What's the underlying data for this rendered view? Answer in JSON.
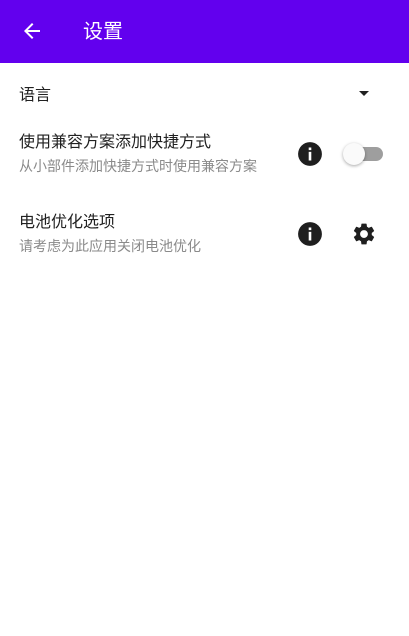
{
  "appbar": {
    "title": "设置",
    "back_icon": "arrow-back-icon",
    "background_color": "#6200ee"
  },
  "language": {
    "label": "语言",
    "dropdown_icon": "arrow-drop-down-icon"
  },
  "compat_shortcut": {
    "title": "使用兼容方案添加快捷方式",
    "subtitle": "从小部件添加快捷方式时使用兼容方案",
    "info_icon": "info-icon",
    "enabled": false
  },
  "battery": {
    "title": "电池优化选项",
    "subtitle": "请考虑为此应用关闭电池优化",
    "info_icon": "info-icon",
    "settings_icon": "gear-icon"
  }
}
